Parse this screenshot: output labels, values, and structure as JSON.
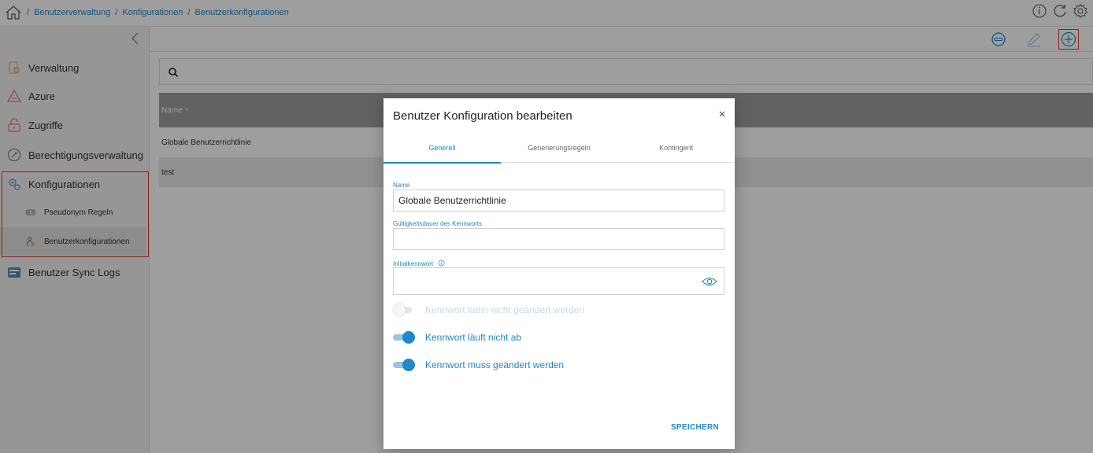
{
  "breadcrumb": {
    "items": [
      "Benutzerverwaltung",
      "Konfigurationen",
      "Benutzerkonfigurationen"
    ],
    "separator": "/"
  },
  "header_icons": [
    "info-icon",
    "refresh-icon",
    "gear-icon"
  ],
  "sidebar": {
    "items": [
      {
        "label": "Verwaltung",
        "icon": "admin-icon"
      },
      {
        "label": "Azure",
        "icon": "azure-icon"
      },
      {
        "label": "Zugriffe",
        "icon": "lock-icon"
      },
      {
        "label": "Berechtigungsverwaltung",
        "icon": "permission-icon"
      },
      {
        "label": "Konfigurationen",
        "icon": "configuration-icon"
      },
      {
        "label": "Benutzer Sync Logs",
        "icon": "sync-log-icon"
      }
    ],
    "subitems": [
      {
        "label": "Pseudonym Regeln",
        "icon": "pseudonym-icon"
      },
      {
        "label": "Benutzerkonfigurationen",
        "icon": "user-config-icon",
        "active": true
      }
    ]
  },
  "toolbar": {
    "buttons": [
      "sync-icon",
      "edit-icon",
      "add-icon"
    ]
  },
  "table": {
    "header": "Name ↑",
    "rows": [
      "Globale Benutzerrichtlinie",
      "test"
    ]
  },
  "modal": {
    "title": "Benutzer Konfiguration bearbeiten",
    "tabs": [
      "Generell",
      "Generierungsregeln",
      "Kontingent"
    ],
    "active_tab": "Generell",
    "fields": {
      "name_label": "Name",
      "name_value": "Globale Benutzerrichtlinie",
      "validity_label": "Gültigkeitsdauer des Kennworts",
      "validity_value": "",
      "initial_label": "Initialkennwort",
      "initial_value": ""
    },
    "toggles": [
      {
        "label": "Kennwort kann nicht geändert werden",
        "on": false
      },
      {
        "label": "Kennwort läuft nicht ab",
        "on": true
      },
      {
        "label": "Kennwort muss geändert werden",
        "on": true
      }
    ],
    "save_label": "SPEICHERN"
  },
  "colors": {
    "accent": "#1e88c9",
    "highlight": "#e53935",
    "table_header": "#9e9e9e"
  }
}
